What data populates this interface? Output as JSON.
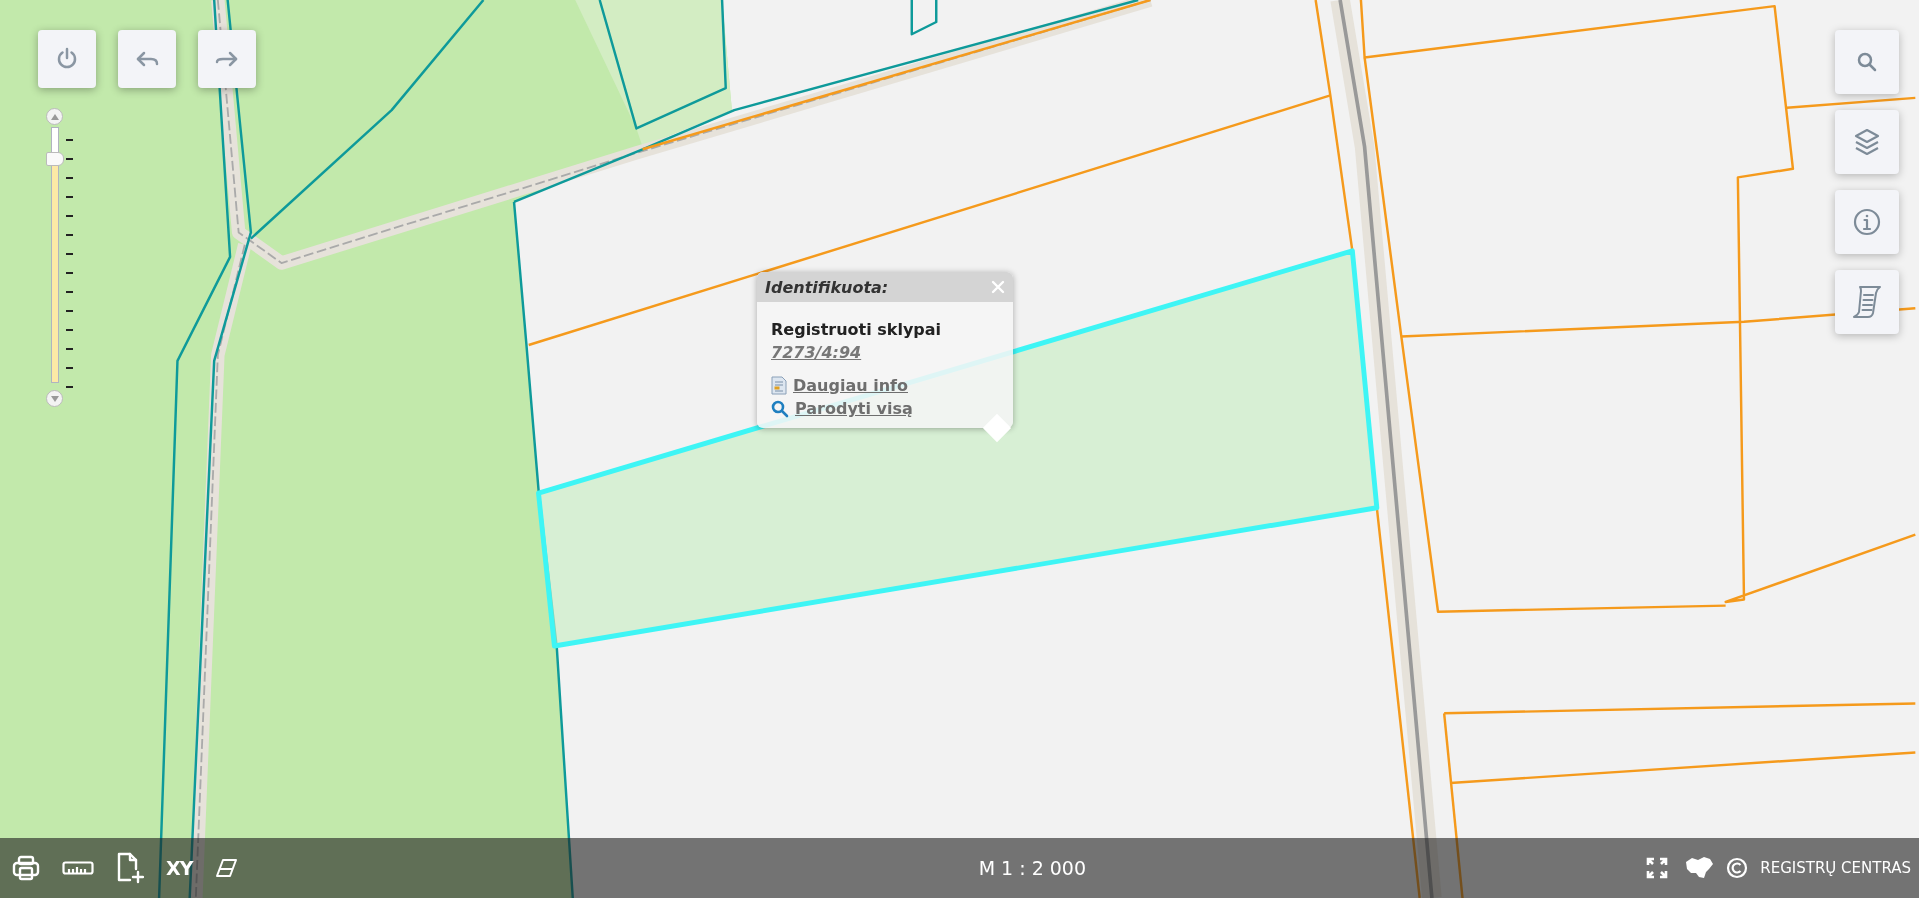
{
  "zoom_slider": {
    "level": 0.88
  },
  "popup": {
    "title": "Identifikuota:",
    "layer": "Registruoti sklypai",
    "parcel": "7273/4:94",
    "links": [
      {
        "kind": "info",
        "label": "Daugiau info"
      },
      {
        "kind": "zoom",
        "label": "Parodyti visą"
      }
    ]
  },
  "status_bar": {
    "coordinates_tool": "XY",
    "scale": "M 1 : 2 000",
    "copyright": "REGISTRŲ CENTRAS"
  }
}
